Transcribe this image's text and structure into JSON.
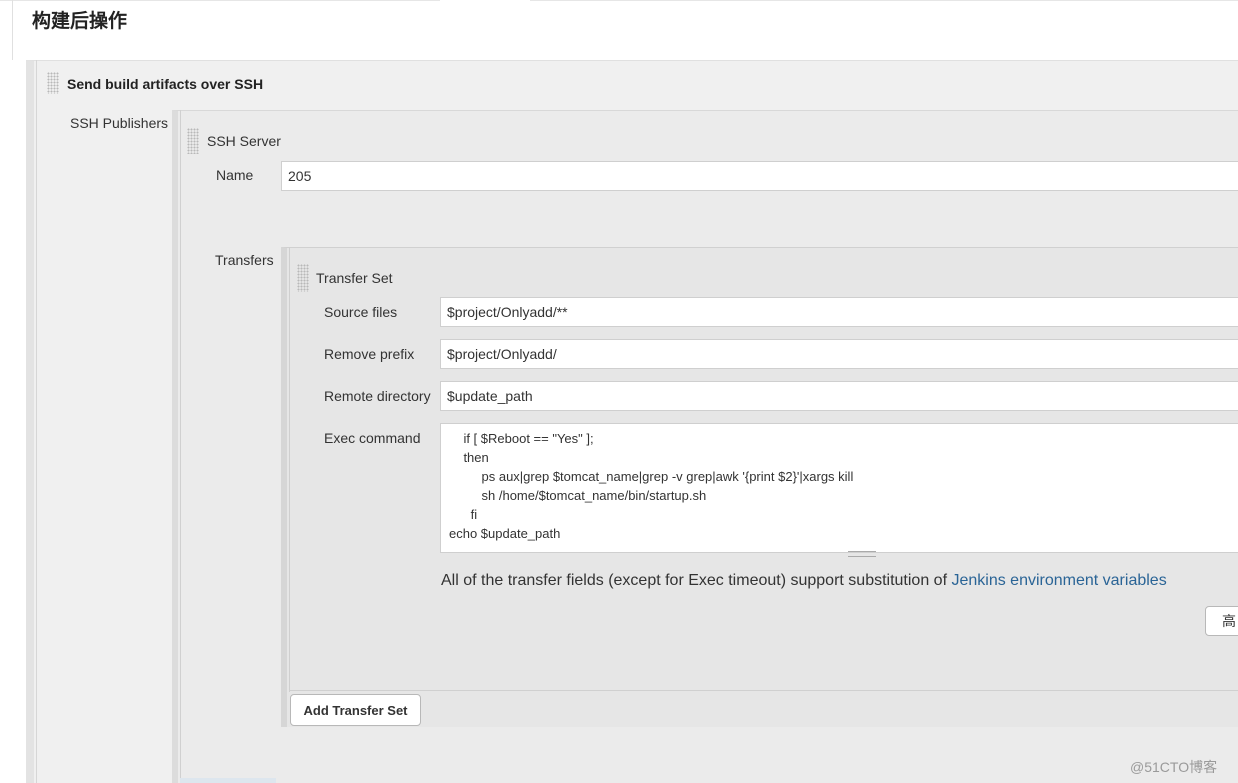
{
  "section": {
    "title": "构建后操作"
  },
  "publisher": {
    "header": "Send build artifacts over SSH",
    "ssh_publishers_label": "SSH Publishers",
    "ssh_server": {
      "header": "SSH Server",
      "name_label": "Name",
      "name_value": "205",
      "transfers_label": "Transfers",
      "transfer_set": {
        "header": "Transfer Set",
        "source_files_label": "Source files",
        "source_files_value": "$project/Onlyadd/**",
        "remove_prefix_label": "Remove prefix",
        "remove_prefix_value": "$project/Onlyadd/",
        "remote_directory_label": "Remote directory",
        "remote_directory_value": "$update_path",
        "exec_command_label": "Exec command",
        "exec_command_value": "    if [ $Reboot == \"Yes\" ];\n    then\n         ps aux|grep $tomcat_name|grep -v grep|awk '{print $2}'|xargs kill\n         sh /home/$tomcat_name/bin/startup.sh\n      fi\necho $update_path",
        "note_text": "All of the transfer fields (except for Exec timeout) support substitution of ",
        "note_link": "Jenkins environment variables",
        "advanced_button": "高"
      },
      "add_transfer_set_button": "Add Transfer Set"
    }
  },
  "watermark": "@51CTO博客",
  "colors": {
    "link": "#2a6496",
    "panel": "#f0f0f0",
    "inner_panel": "#ebebeb",
    "transfer_panel": "#e6e6e6"
  }
}
